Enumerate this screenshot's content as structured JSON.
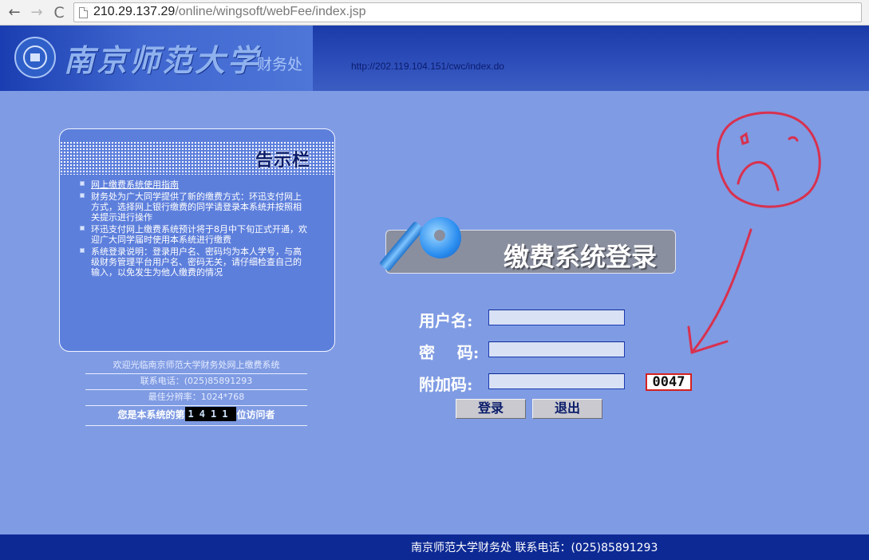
{
  "browser": {
    "back_icon": "←",
    "forward_icon": "→",
    "reload_icon": "C",
    "url_host": "210.29.137.29",
    "url_path": "/online/wingsoft/webFee/index.jsp"
  },
  "header": {
    "university_name": "南京师范大学",
    "department": "财务处",
    "link_text": "http://202.119.104.151/cwc/index.do"
  },
  "notice_board": {
    "title": "告示栏",
    "items": [
      "网上缴费系统使用指南",
      "财务处为广大同学提供了新的缴费方式：环迅支付网上方式，选择网上银行缴费的同学请登录本系统并按照相关提示进行操作",
      "环迅支付网上缴费系统预计将于8月中下旬正式开通，欢迎广大同学届时使用本系统进行缴费",
      "系统登录说明：登录用户名、密码均为本人学号，与高级财务管理平台用户名、密码无关，请仔细检查自己的输入，以免发生为他人缴费的情况"
    ]
  },
  "info": {
    "welcome": "欢迎光临南京师范大学财务处网上缴费系统",
    "phone": "联系电话：(025)85891293",
    "resolution": "最佳分辨率：1024*768",
    "visitor_prefix": "您是本系统的第",
    "visitor_count": "1411",
    "visitor_suffix": "位访问者"
  },
  "login": {
    "title": "缴费系统登录",
    "username_label": "用户名:",
    "password_label": "密    码:",
    "captcha_label": "附加码:",
    "username_value": "",
    "password_value": "",
    "captcha_value": "",
    "captcha_code": "0047",
    "login_button": "登录",
    "exit_button": "退出"
  },
  "footer": {
    "text": "南京师范大学财务处 联系电话：(025)85891293"
  },
  "colors": {
    "page_background": "#7f9be3",
    "header_dark": "#0c2a95",
    "annotation": "#d8314f"
  },
  "icons": [
    "back-arrow-icon",
    "forward-arrow-icon",
    "reload-icon",
    "page-icon",
    "university-seal-icon",
    "key-icon",
    "bullet-icon"
  ]
}
